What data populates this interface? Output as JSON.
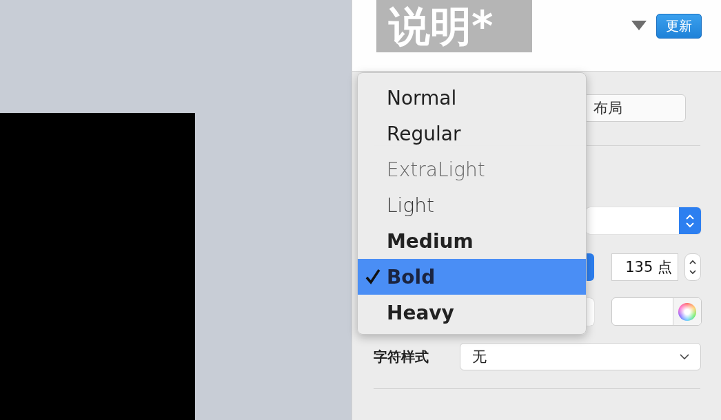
{
  "header": {
    "style_name": "说明*",
    "update_button": "更新"
  },
  "layout_button": "布局",
  "font_size": "135 点",
  "character_style": {
    "label": "字符样式",
    "value": "无"
  },
  "weight_menu": [
    {
      "label": "Normal",
      "kind": "normal",
      "selected": false
    },
    {
      "label": "Regular",
      "kind": "regular",
      "selected": false
    },
    {
      "label": "ExtraLight",
      "kind": "extralight",
      "selected": false
    },
    {
      "label": "Light",
      "kind": "light",
      "selected": false
    },
    {
      "label": "Medium",
      "kind": "medium",
      "selected": false
    },
    {
      "label": "Bold",
      "kind": "bold",
      "selected": true
    },
    {
      "label": "Heavy",
      "kind": "heavy",
      "selected": false
    }
  ]
}
